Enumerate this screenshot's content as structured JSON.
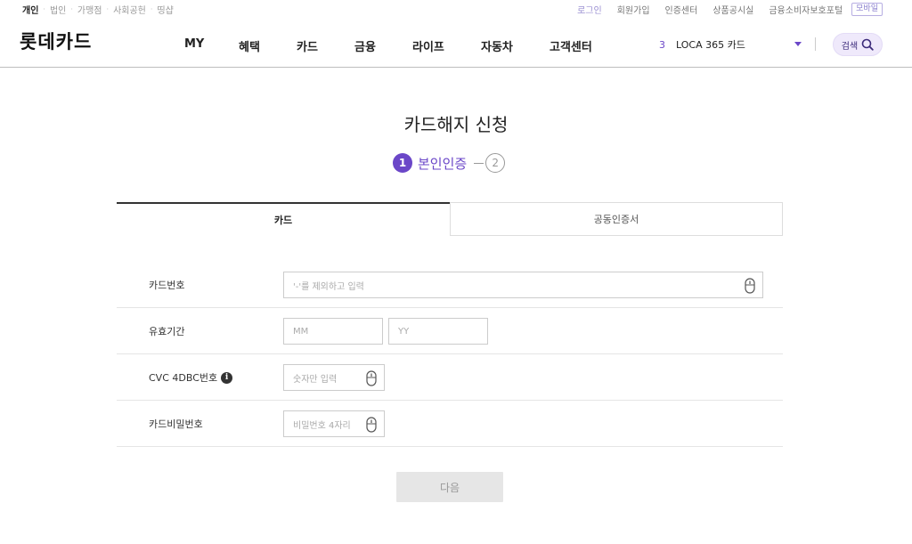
{
  "topbar": {
    "segments": [
      "개인",
      "법인",
      "가맹점",
      "사회공헌",
      "띵샵"
    ],
    "util_links": [
      "로그인",
      "회원가입",
      "인증센터",
      "상품공시실",
      "금융소비자보호포털"
    ],
    "mobile": "모바일"
  },
  "header": {
    "logo": "롯데카드",
    "nav": [
      "MY",
      "혜택",
      "카드",
      "금융",
      "라이프",
      "자동차",
      "고객센터"
    ],
    "promo_number": "3",
    "promo_text": "LOCA 365 카드",
    "search_label": "검색"
  },
  "page": {
    "title": "카드해지 신청",
    "step1_number": "1",
    "step1_label": "본인인증",
    "step2_number": "2"
  },
  "tabs": [
    "카드",
    "공동인증서"
  ],
  "form": {
    "card_number_label": "카드번호",
    "card_number_placeholder": "'-'를 제외하고 입력",
    "expiry_label": "유효기간",
    "month_placeholder": "MM",
    "year_placeholder": "YY",
    "cvc_label": "CVC 4DBC번호",
    "cvc_placeholder": "숫자만 입력",
    "password_label": "카드비밀번호",
    "password_placeholder": "비밀번호 4자리"
  },
  "next_button": "다음",
  "colors": {
    "accent": "#6b47c8",
    "search_bg": "#efe9fb"
  },
  "icons": {
    "info": "info-icon",
    "mouse": "mouse-icon",
    "search": "search-icon"
  }
}
